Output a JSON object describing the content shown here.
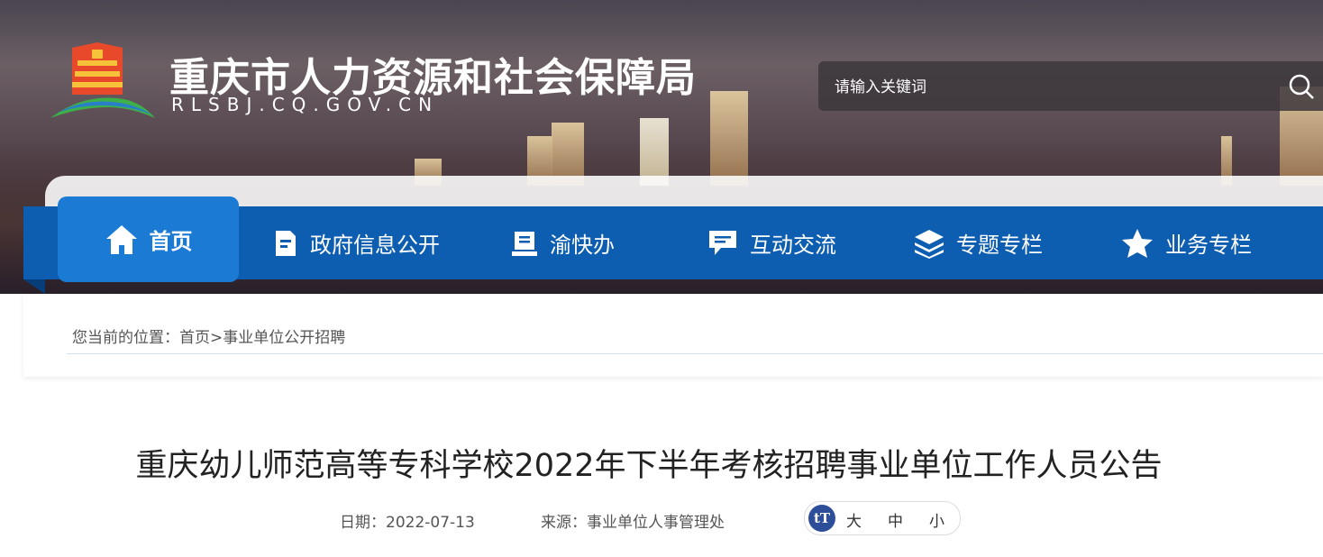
{
  "header": {
    "site_title": "重庆市人力资源和社会保障局",
    "site_domain": "RLSBJ.CQ.GOV.CN",
    "search_placeholder": "请输入关键词"
  },
  "nav": {
    "items": [
      {
        "label": "首页",
        "icon": "home-icon",
        "active": true
      },
      {
        "label": "政府信息公开",
        "icon": "document-icon"
      },
      {
        "label": "渝快办",
        "icon": "service-icon"
      },
      {
        "label": "互动交流",
        "icon": "chat-icon"
      },
      {
        "label": "专题专栏",
        "icon": "layers-icon"
      },
      {
        "label": "业务专栏",
        "icon": "star-icon"
      }
    ],
    "colors": {
      "bar": "#0d5db0",
      "active": "#1a7ad4"
    }
  },
  "breadcrumb": {
    "prefix": "您当前的位置：",
    "home": "首页",
    "separator": ">",
    "current": "事业单位公开招聘"
  },
  "article": {
    "title": "重庆幼儿师范高等专科学校2022年下半年考核招聘事业单位工作人员公告",
    "date_label": "日期：",
    "date": "2022-07-13",
    "source_label": "来源：",
    "source": "事业单位人事管理处",
    "font_icon": "tT",
    "font_sizes": [
      "大",
      "中",
      "小"
    ]
  }
}
